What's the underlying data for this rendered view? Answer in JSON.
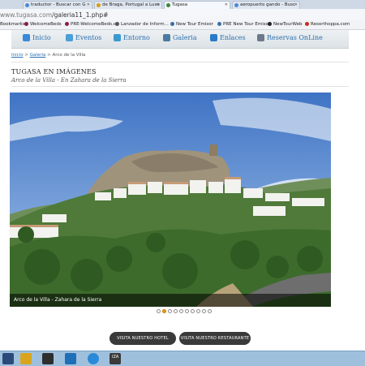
{
  "browser": {
    "tabs": [
      {
        "label": "traductor - Buscar con G",
        "color": "#4a8ad4"
      },
      {
        "label": "de Braga, Portugal a Luso",
        "color": "#d4a017"
      },
      {
        "label": "Tugasa",
        "color": "#3a8a3a"
      },
      {
        "label": "aeropuerto gando - Busc",
        "color": "#4a8ad4"
      }
    ],
    "url_host": "www.tugasa.com",
    "url_path": "/galeria11_1.php#",
    "bookmarks": [
      "Bookmarks",
      "WelcomeBeds",
      "PRE-WelcomeBeds.c",
      "Lanzador de Inform...",
      "New Tour Emisor",
      "PRE New Tour Emisor",
      "NewTourWeb",
      "Resorthoppa.com"
    ]
  },
  "nav": {
    "items": [
      {
        "label": "Inicio",
        "icon": "home-icon"
      },
      {
        "label": "Eventos",
        "icon": "events-icon"
      },
      {
        "label": "Entorno",
        "icon": "environment-icon"
      },
      {
        "label": "Galeria",
        "icon": "gallery-icon"
      },
      {
        "label": "Enlaces",
        "icon": "links-icon"
      },
      {
        "label": "Reservas OnLine",
        "icon": "reservations-icon"
      }
    ]
  },
  "breadcrumb": {
    "home": "Inicio",
    "sep1": " > ",
    "gallery": "Galeria",
    "sep2": " > ",
    "current": "Arco de la Villa"
  },
  "heading": {
    "title": "TUGASA EN IMÁGENES",
    "subtitle": "Arco de la Villa - En Zahara de la Sierra"
  },
  "photo": {
    "caption": "Arco de la Villa - Zahara de la Sierra"
  },
  "slider": {
    "count": 10,
    "active": 1
  },
  "buttons": {
    "hotel": "VISITA NUESTRO HOTEL",
    "restaurant": "VISITA NUESTRO RESTAURANTE"
  },
  "taskbar": {
    "label": "IZA",
    "colors": [
      "#d9a520",
      "#2e2e2e",
      "#1e6fb8",
      "#2a8ad8",
      "#3a3a3a"
    ]
  }
}
